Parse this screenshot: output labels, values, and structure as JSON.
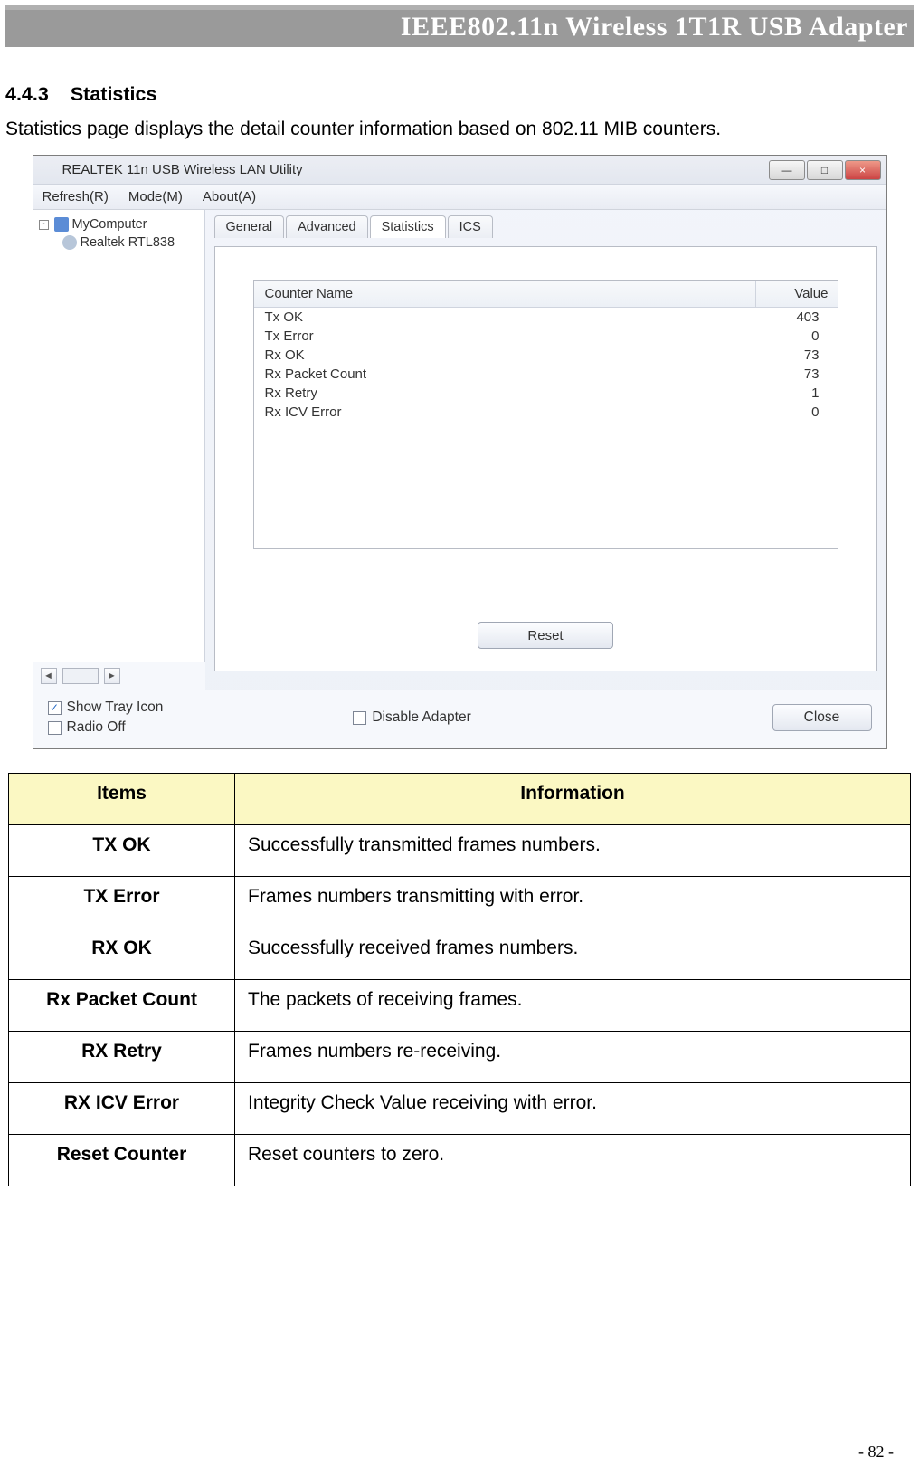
{
  "header": {
    "title": "IEEE802.11n Wireless 1T1R USB Adapter"
  },
  "section": {
    "number": "4.4.3",
    "title": "Statistics",
    "intro": "Statistics page displays the detail counter information based on 802.11 MIB counters."
  },
  "window": {
    "title": "REALTEK 11n USB Wireless LAN Utility",
    "menus": [
      "Refresh(R)",
      "Mode(M)",
      "About(A)"
    ],
    "win_buttons": {
      "min": "—",
      "max": "□",
      "close": "×"
    },
    "tree": {
      "toggle": "-",
      "root": "MyComputer",
      "child": "Realtek RTL838"
    },
    "tabs": [
      "General",
      "Advanced",
      "Statistics",
      "ICS"
    ],
    "active_tab_index": 2,
    "stats_header": {
      "name": "Counter Name",
      "value": "Value"
    },
    "stats": [
      {
        "name": "Tx OK",
        "value": "403"
      },
      {
        "name": "Tx Error",
        "value": "0"
      },
      {
        "name": "Rx OK",
        "value": "73"
      },
      {
        "name": "Rx Packet Count",
        "value": "73"
      },
      {
        "name": "Rx Retry",
        "value": "1"
      },
      {
        "name": "Rx ICV Error",
        "value": "0"
      }
    ],
    "reset_label": "Reset",
    "scroll_arrows": {
      "left": "◄",
      "right": "►"
    },
    "checkboxes": {
      "tray": {
        "label": "Show Tray Icon",
        "checked": true
      },
      "radio": {
        "label": "Radio Off",
        "checked": false
      },
      "disable": {
        "label": "Disable Adapter",
        "checked": false
      }
    },
    "close_label": "Close"
  },
  "info_table": {
    "headers": {
      "items": "Items",
      "info": "Information"
    },
    "rows": [
      {
        "item": "TX OK",
        "info": "Successfully transmitted frames numbers."
      },
      {
        "item": "TX Error",
        "info": "Frames numbers transmitting with error."
      },
      {
        "item": "RX OK",
        "info": "Successfully received frames numbers."
      },
      {
        "item": "Rx Packet Count",
        "info": "The packets of receiving frames."
      },
      {
        "item": "RX Retry",
        "info": "Frames numbers re-receiving."
      },
      {
        "item": "RX ICV Error",
        "info": "Integrity Check Value receiving with error."
      },
      {
        "item": "Reset Counter",
        "info": "Reset counters to zero."
      }
    ]
  },
  "page_number": "- 82 -"
}
